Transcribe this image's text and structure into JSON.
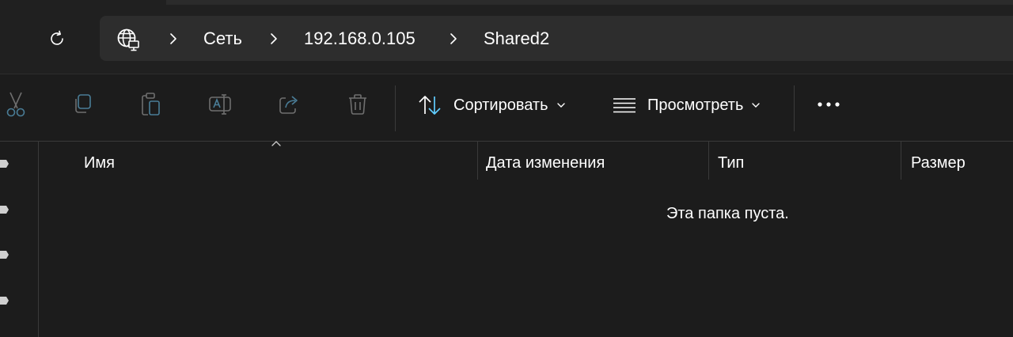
{
  "address": {
    "refresh_icon": "refresh-icon",
    "network_icon": "network-globe-icon",
    "breadcrumbs": [
      "Сеть",
      "192.168.0.105",
      "Shared2"
    ]
  },
  "toolbar": {
    "icons": [
      "cut-icon",
      "copy-icon",
      "paste-icon",
      "rename-icon",
      "share-icon",
      "delete-icon",
      "more-icon"
    ],
    "sort_label": "Сортировать",
    "view_label": "Просмотреть"
  },
  "columns": {
    "name": "Имя",
    "date": "Дата изменения",
    "type": "Тип",
    "size": "Размер"
  },
  "empty_message": "Эта папка пуста.",
  "colors": {
    "background": "#1c1c1c",
    "address_bar": "#2d2d2d",
    "accent": "#60cdff",
    "disabled_icon": "#6f6f6f"
  }
}
